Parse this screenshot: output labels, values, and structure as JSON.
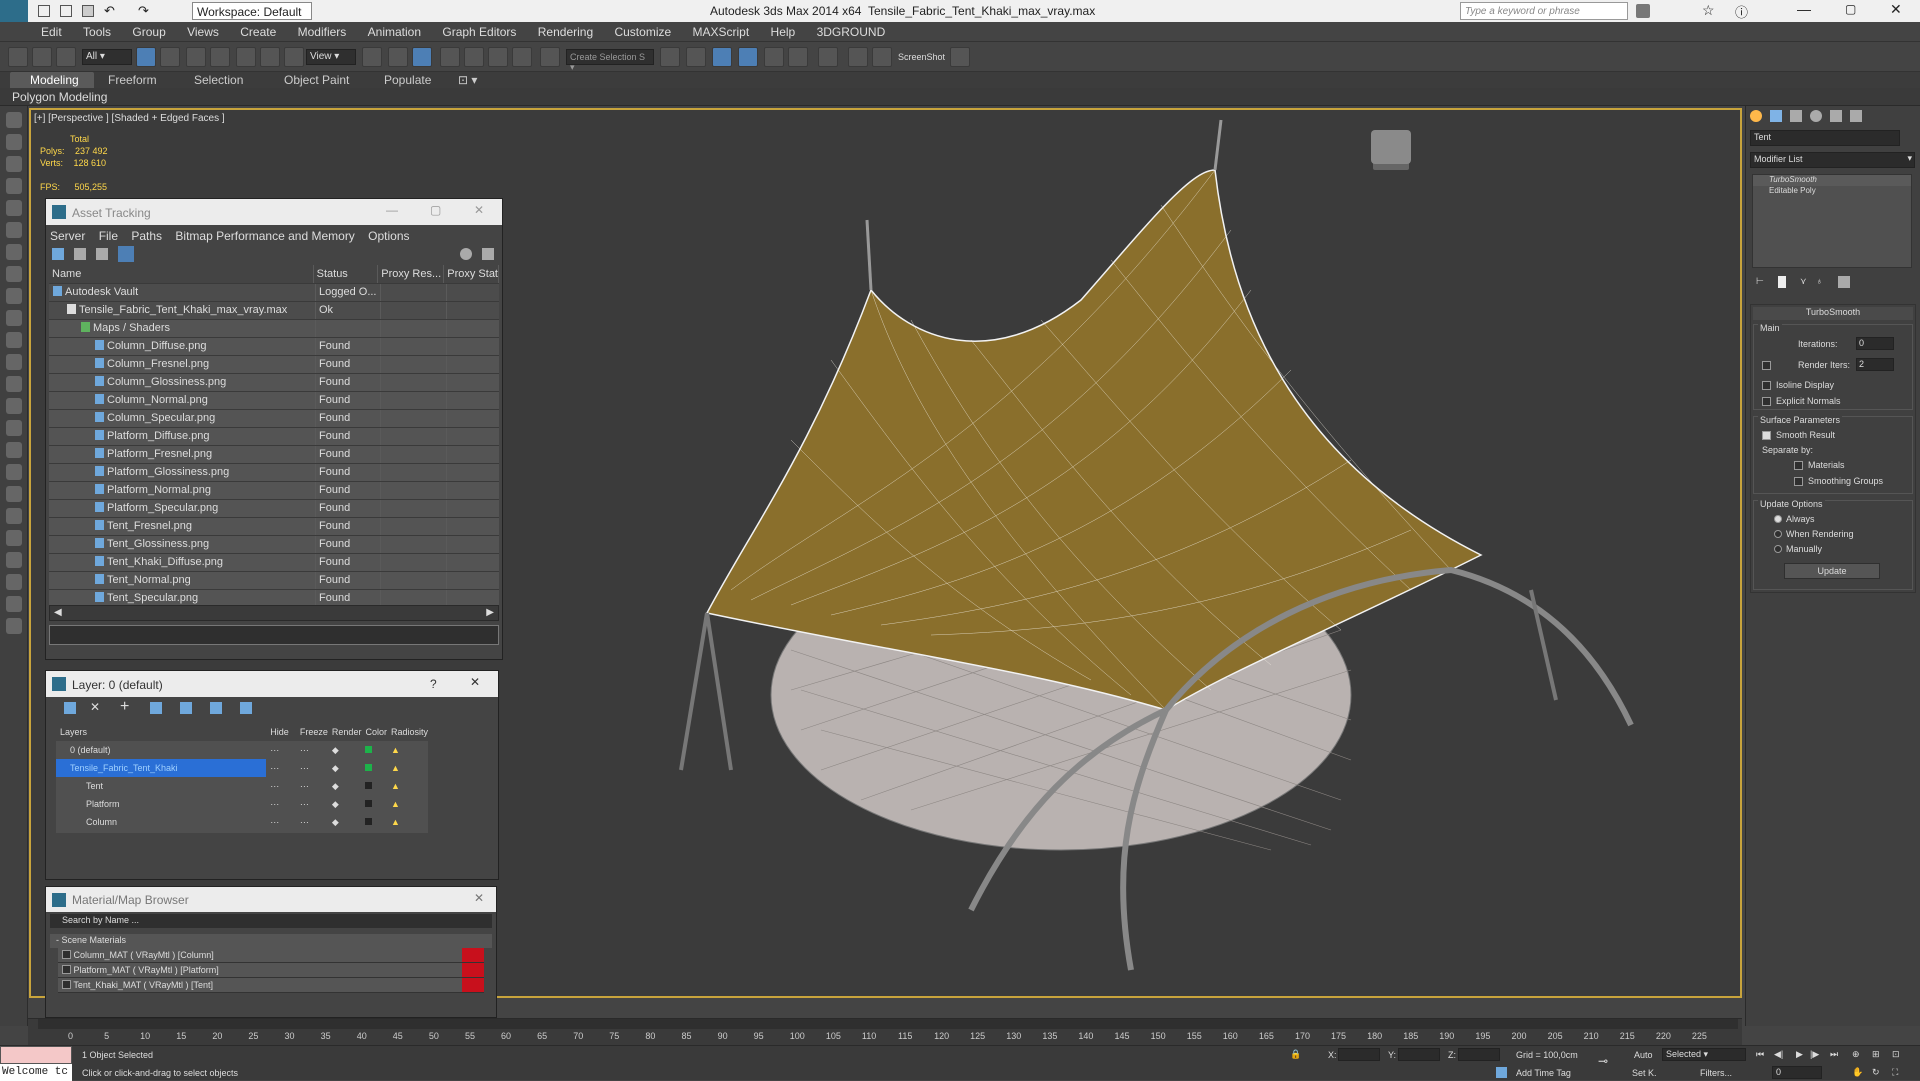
{
  "title": {
    "app": "Autodesk 3ds Max  2014 x64",
    "file": "Tensile_Fabric_Tent_Khaki_max_vray.max",
    "workspace": "Workspace: Default",
    "search_placeholder": "Type a keyword or phrase"
  },
  "menu": [
    "Edit",
    "Tools",
    "Group",
    "Views",
    "Create",
    "Modifiers",
    "Animation",
    "Graph Editors",
    "Rendering",
    "Customize",
    "MAXScript",
    "Help",
    "3DGROUND"
  ],
  "toolbar": {
    "filter": "All",
    "view": "View",
    "selection_set": "Create Selection S",
    "screenshot": "ScreenShot"
  },
  "ribbon": {
    "tabs": [
      "Modeling",
      "Freeform",
      "Selection",
      "Object Paint",
      "Populate"
    ],
    "sub": "Polygon Modeling"
  },
  "viewport": {
    "label": "[+] [Perspective ] [Shaded + Edged Faces ]",
    "stats": {
      "total": "Total",
      "polys_label": "Polys:",
      "polys": "237 492",
      "verts_label": "Verts:",
      "verts": "128 610",
      "fps_label": "FPS:",
      "fps": "505,255"
    }
  },
  "asset": {
    "title": "Asset Tracking",
    "menu": [
      "Server",
      "File",
      "Paths",
      "Bitmap Performance and Memory",
      "Options"
    ],
    "columns": [
      "Name",
      "Status",
      "Proxy Res...",
      "Proxy Stat"
    ],
    "rows": [
      {
        "name": "Autodesk Vault",
        "status": "Logged O...",
        "indent": 1
      },
      {
        "name": "Tensile_Fabric_Tent_Khaki_max_vray.max",
        "status": "Ok",
        "indent": 2
      },
      {
        "name": "Maps / Shaders",
        "status": "",
        "indent": 3
      },
      {
        "name": "Column_Diffuse.png",
        "status": "Found",
        "indent": 4
      },
      {
        "name": "Column_Fresnel.png",
        "status": "Found",
        "indent": 4
      },
      {
        "name": "Column_Glossiness.png",
        "status": "Found",
        "indent": 4
      },
      {
        "name": "Column_Normal.png",
        "status": "Found",
        "indent": 4
      },
      {
        "name": "Column_Specular.png",
        "status": "Found",
        "indent": 4
      },
      {
        "name": "Platform_Diffuse.png",
        "status": "Found",
        "indent": 4
      },
      {
        "name": "Platform_Fresnel.png",
        "status": "Found",
        "indent": 4
      },
      {
        "name": "Platform_Glossiness.png",
        "status": "Found",
        "indent": 4
      },
      {
        "name": "Platform_Normal.png",
        "status": "Found",
        "indent": 4
      },
      {
        "name": "Platform_Specular.png",
        "status": "Found",
        "indent": 4
      },
      {
        "name": "Tent_Fresnel.png",
        "status": "Found",
        "indent": 4
      },
      {
        "name": "Tent_Glossiness.png",
        "status": "Found",
        "indent": 4
      },
      {
        "name": "Tent_Khaki_Diffuse.png",
        "status": "Found",
        "indent": 4
      },
      {
        "name": "Tent_Normal.png",
        "status": "Found",
        "indent": 4
      },
      {
        "name": "Tent_Specular.png",
        "status": "Found",
        "indent": 4
      }
    ]
  },
  "layer": {
    "title": "Layer: 0 (default)",
    "help": "?",
    "columns": [
      "Layers",
      "Hide",
      "Freeze",
      "Render",
      "Color",
      "Radiosity"
    ],
    "rows": [
      {
        "name": "0 (default)"
      },
      {
        "name": "Tensile_Fabric_Tent_Khaki"
      },
      {
        "name": "Tent"
      },
      {
        "name": "Platform"
      },
      {
        "name": "Column"
      }
    ]
  },
  "material": {
    "title": "Material/Map Browser",
    "search": "Search by Name ...",
    "section": "- Scene Materials",
    "items": [
      "Column_MAT  ( VRayMtl )  [Column]",
      "Platform_MAT  ( VRayMtl )  [Platform]",
      "Tent_Khaki_MAT  ( VRayMtl )  [Tent]"
    ]
  },
  "cmd": {
    "object_name": "Tent",
    "modifier_list": "Modifier List",
    "stack": [
      "TurboSmooth",
      "Editable Poly"
    ],
    "rollout": "TurboSmooth",
    "main": "Main",
    "iterations_label": "Iterations:",
    "iterations": "0",
    "render_iters_label": "Render Iters:",
    "render_iters": "2",
    "isoline": "Isoline Display",
    "explicit": "Explicit Normals",
    "surface": "Surface Parameters",
    "smooth_result": "Smooth Result",
    "separate": "Separate by:",
    "materials": "Materials",
    "smoothing": "Smoothing Groups",
    "update_options": "Update Options",
    "always": "Always",
    "when_rendering": "When Rendering",
    "manually": "Manually",
    "update_btn": "Update"
  },
  "timeline": {
    "ticks": [
      "0",
      "5",
      "10",
      "15",
      "20",
      "25",
      "30",
      "35",
      "40",
      "45",
      "50",
      "55",
      "60",
      "65",
      "70",
      "75",
      "80",
      "85",
      "90",
      "95",
      "100",
      "105",
      "110",
      "115",
      "120",
      "125",
      "130",
      "135",
      "140",
      "145",
      "150",
      "155",
      "160",
      "165",
      "170",
      "175",
      "180",
      "185",
      "190",
      "195",
      "200",
      "205",
      "210",
      "215",
      "220",
      "225"
    ]
  },
  "status": {
    "welcome": "Welcome tc",
    "selected": "1 Object Selected",
    "hint": "Click or click-and-drag to select objects",
    "x": "X:",
    "y": "Y:",
    "z": "Z:",
    "grid": "Grid = 100,0cm",
    "add_time_tag": "Add Time Tag",
    "auto": "Auto",
    "set_key": "Set K.",
    "key_mode": "Selected",
    "filters": "Filters...",
    "frame": "0"
  }
}
